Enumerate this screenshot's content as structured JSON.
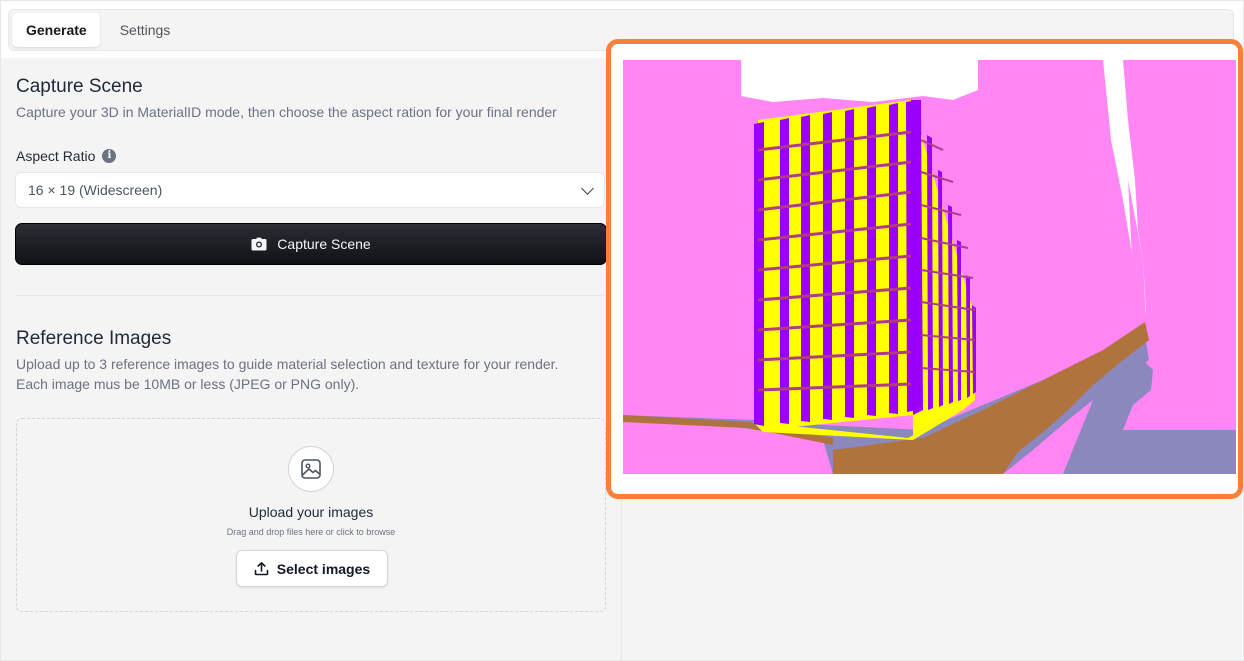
{
  "tabs": [
    {
      "label": "Generate",
      "active": true
    },
    {
      "label": "Settings",
      "active": false
    }
  ],
  "capture": {
    "title": "Capture Scene",
    "description": "Capture your 3D in MaterialID mode, then choose the aspect ration for your final render",
    "aspect_label": "Aspect Ratio",
    "aspect_value": "16 × 19 (Widescreen)",
    "button_label": "Capture Scene"
  },
  "reference": {
    "title": "Reference Images",
    "description_line1": "Upload up to 3 reference images to guide material selection and texture for your render.",
    "description_line2": "Each image mus be 10MB or less (JPEG or PNG only).",
    "upload_title": "Upload your images",
    "upload_sub": "Drag and drop files here or click to browse",
    "select_button": "Select images"
  },
  "icons": {
    "info": "info-icon",
    "camera": "camera-icon",
    "image": "image-icon",
    "upload": "upload-icon",
    "chevron": "chevron-down-icon"
  },
  "colors": {
    "highlight_border": "#f8803a",
    "button_dark": "#18191d",
    "material_sky": "#ff86f4",
    "material_building": "#ffff00",
    "material_frame": "#9b00ff",
    "material_road": "#b0733d",
    "material_sidewalk": "#8a88bd"
  }
}
